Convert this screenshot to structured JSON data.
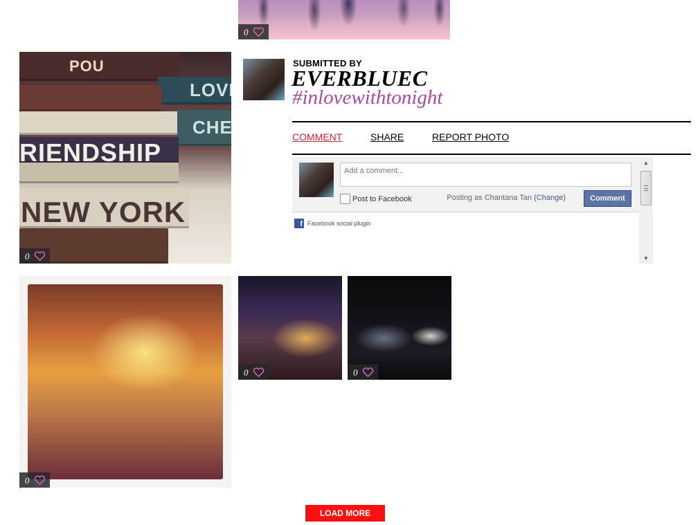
{
  "photos": [
    {
      "id": "crowd",
      "likes": "0",
      "alt": "crowd"
    },
    {
      "id": "books",
      "likes": "0"
    },
    {
      "id": "restaurant",
      "likes": "0"
    },
    {
      "id": "night1",
      "likes": "0"
    },
    {
      "id": "night2",
      "likes": "0"
    }
  ],
  "books_art": {
    "lines": [
      "POU",
      "LOVE",
      "RIENDSHIP",
      "NEW YORK",
      "CHER"
    ]
  },
  "detail": {
    "submitted_label": "SUBMITTED BY",
    "username": "EVERBLUEC",
    "caption": "#inlovewithtonight",
    "actions": {
      "comment": "COMMENT",
      "share": "SHARE",
      "report": "REPORT PHOTO"
    }
  },
  "comments": {
    "placeholder": "Add a comment...",
    "post_to_facebook": "Post to Facebook",
    "posting_as": "Posting as Chantana Tan",
    "change": "(Change)",
    "button": "Comment",
    "plugin_label": "Facebook social plugin"
  },
  "load_more": "LOAD MORE",
  "colors": {
    "accent_red": "#ff1010",
    "caption_purple": "#a84b9e",
    "active_link": "#c8283b",
    "facebook_blue": "#3b5998"
  }
}
